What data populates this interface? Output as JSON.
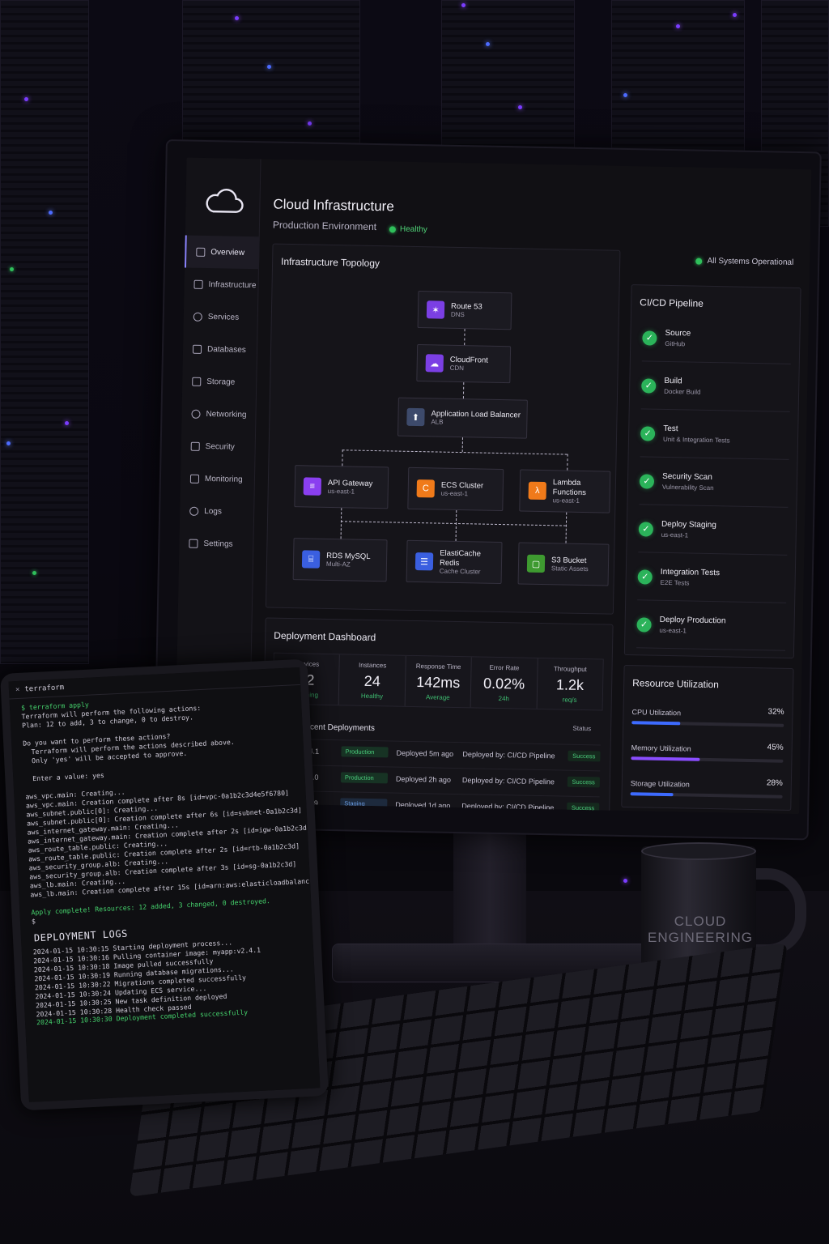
{
  "monitor": {
    "title": "Cloud Infrastructure",
    "subtitle": "Production Environment",
    "health": "Healthy",
    "system_status": "All Systems Operational",
    "nav": [
      {
        "label": "Overview",
        "icon": "home-icon",
        "active": true
      },
      {
        "label": "Infrastructure",
        "icon": "server-icon"
      },
      {
        "label": "Services",
        "icon": "services-icon"
      },
      {
        "label": "Databases",
        "icon": "database-icon"
      },
      {
        "label": "Storage",
        "icon": "storage-icon"
      },
      {
        "label": "Networking",
        "icon": "network-icon"
      },
      {
        "label": "Security",
        "icon": "shield-icon"
      },
      {
        "label": "Monitoring",
        "icon": "monitor-icon"
      },
      {
        "label": "Logs",
        "icon": "logs-icon"
      },
      {
        "label": "Settings",
        "icon": "gear-icon"
      }
    ],
    "topology": {
      "title": "Infrastructure Topology",
      "nodes": [
        {
          "name": "Route 53",
          "sub": "DNS",
          "color": "#7b3fe4"
        },
        {
          "name": "CloudFront",
          "sub": "CDN",
          "color": "#7b3fe4"
        },
        {
          "name": "Application Load Balancer",
          "sub": "ALB",
          "color": "#3d4a6b"
        },
        {
          "name": "API Gateway",
          "sub": "us-east-1",
          "color": "#8a3ff0"
        },
        {
          "name": "ECS Cluster",
          "sub": "us-east-1",
          "color": "#f07a1a"
        },
        {
          "name": "Lambda Functions",
          "sub": "us-east-1",
          "color": "#f07a1a"
        },
        {
          "name": "RDS MySQL",
          "sub": "Multi-AZ",
          "color": "#3a5fe0"
        },
        {
          "name": "ElastiCache Redis",
          "sub": "Cache Cluster",
          "color": "#3a5fe0"
        },
        {
          "name": "S3 Bucket",
          "sub": "Static Assets",
          "color": "#3e9a30"
        }
      ]
    },
    "deployment": {
      "title": "Deployment Dashboard",
      "stats": [
        {
          "label": "Services",
          "value": "12",
          "sub": "Running"
        },
        {
          "label": "Instances",
          "value": "24",
          "sub": "Healthy"
        },
        {
          "label": "Response Time",
          "value": "142ms",
          "sub": "Average"
        },
        {
          "label": "Error Rate",
          "value": "0.02%",
          "sub": "24h"
        },
        {
          "label": "Throughput",
          "value": "1.2k",
          "sub": "req/s"
        }
      ],
      "recent_title": "Recent Deployments",
      "status_header": "Status",
      "rows": [
        {
          "version": "v2.4.1",
          "env": "Production",
          "ago": "Deployed 5m ago",
          "by": "Deployed by: CI/CD Pipeline",
          "status": "Success"
        },
        {
          "version": "v2.4.0",
          "env": "Production",
          "ago": "Deployed 2h ago",
          "by": "Deployed by: CI/CD Pipeline",
          "status": "Success"
        },
        {
          "version": "v2.3.9",
          "env": "Staging",
          "ago": "Deployed 1d ago",
          "by": "Deployed by: CI/CD Pipeline",
          "status": "Success"
        }
      ]
    },
    "cicd": {
      "title": "CI/CD Pipeline",
      "steps": [
        {
          "name": "Source",
          "sub": "GitHub"
        },
        {
          "name": "Build",
          "sub": "Docker Build"
        },
        {
          "name": "Test",
          "sub": "Unit & Integration Tests"
        },
        {
          "name": "Security Scan",
          "sub": "Vulnerability Scan"
        },
        {
          "name": "Deploy Staging",
          "sub": "us-east-1"
        },
        {
          "name": "Integration Tests",
          "sub": "E2E Tests"
        },
        {
          "name": "Deploy Production",
          "sub": "us-east-1"
        }
      ]
    },
    "resources": {
      "title": "Resource Utilization",
      "items": [
        {
          "label": "CPU Utilization",
          "value": "32%",
          "fraction": 0.32,
          "color": "#3d6bff"
        },
        {
          "label": "Memory Utilization",
          "value": "45%",
          "fraction": 0.45,
          "color": "#8a4dff"
        },
        {
          "label": "Storage Utilization",
          "value": "28%",
          "fraction": 0.28,
          "color": "#3d6bff"
        }
      ]
    }
  },
  "terminal": {
    "tab": "terraform",
    "lines": [
      {
        "text": "$ terraform apply",
        "style": "cmd"
      },
      {
        "text": "Terraform will perform the following actions:"
      },
      {
        "text": "Plan: 12 to add, 3 to change, 0 to destroy."
      },
      {
        "text": ""
      },
      {
        "text": "Do you want to perform these actions?"
      },
      {
        "text": "  Terraform will perform the actions described above."
      },
      {
        "text": "  Only 'yes' will be accepted to approve."
      },
      {
        "text": ""
      },
      {
        "text": "  Enter a value: yes"
      },
      {
        "text": ""
      },
      {
        "text": "aws_vpc.main: Creating..."
      },
      {
        "text": "aws_vpc.main: Creation complete after 8s [id=vpc-0a1b2c3d4e5f6780]"
      },
      {
        "text": "aws_subnet.public[0]: Creating..."
      },
      {
        "text": "aws_subnet.public[0]: Creation complete after 6s [id=subnet-0a1b2c3d]"
      },
      {
        "text": "aws_internet_gateway.main: Creating..."
      },
      {
        "text": "aws_internet_gateway.main: Creation complete after 2s [id=igw-0a1b2c3d]"
      },
      {
        "text": "aws_route_table.public: Creating..."
      },
      {
        "text": "aws_route_table.public: Creation complete after 2s [id=rtb-0a1b2c3d]"
      },
      {
        "text": "aws_security_group.alb: Creating..."
      },
      {
        "text": "aws_security_group.alb: Creation complete after 3s [id=sg-0a1b2c3d]"
      },
      {
        "text": "aws_lb.main: Creating..."
      },
      {
        "text": "aws_lb.main: Creation complete after 15s [id=arn:aws:elasticloadbalanc"
      },
      {
        "text": ""
      },
      {
        "text": "Apply complete! Resources: 12 added, 3 changed, 0 destroyed.",
        "style": "green"
      },
      {
        "text": "$"
      }
    ],
    "logs_title": "DEPLOYMENT LOGS",
    "logs": [
      {
        "text": "2024-01-15 10:30:15 Starting deployment process..."
      },
      {
        "text": "2024-01-15 10:30:16 Pulling container image: myapp:v2.4.1"
      },
      {
        "text": "2024-01-15 10:30:18 Image pulled successfully"
      },
      {
        "text": "2024-01-15 10:30:19 Running database migrations..."
      },
      {
        "text": "2024-01-15 10:30:22 Migrations completed successfully"
      },
      {
        "text": "2024-01-15 10:30:24 Updating ECS service..."
      },
      {
        "text": "2024-01-15 10:30:25 New task definition deployed"
      },
      {
        "text": "2024-01-15 10:30:28 Health check passed"
      },
      {
        "text": "2024-01-15 10:30:30 Deployment completed successfully",
        "style": "green"
      }
    ]
  },
  "mug": {
    "line1": "CLOUD",
    "line2": "ENGINEERING"
  }
}
